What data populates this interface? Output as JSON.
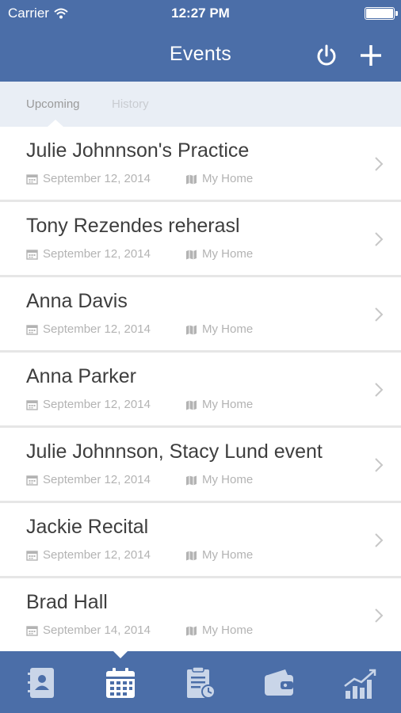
{
  "status_bar": {
    "carrier": "Carrier",
    "time": "12:27 PM"
  },
  "nav": {
    "title": "Events",
    "power_icon": "power-icon",
    "add_icon": "plus-icon"
  },
  "segments": {
    "upcoming": "Upcoming",
    "history": "History",
    "selected": "Upcoming"
  },
  "events": [
    {
      "title": "Julie Johnnson's Practice",
      "date": "September 12, 2014",
      "location": "My Home"
    },
    {
      "title": "Tony Rezendes reherasl",
      "date": "September 12, 2014",
      "location": "My Home"
    },
    {
      "title": "Anna Davis",
      "date": "September 12, 2014",
      "location": "My Home"
    },
    {
      "title": "Anna Parker",
      "date": "September 12, 2014",
      "location": "My Home"
    },
    {
      "title": "Julie Johnnson, Stacy Lund event",
      "date": "September 12, 2014",
      "location": "My Home"
    },
    {
      "title": "Jackie Recital",
      "date": "September 12, 2014",
      "location": "My Home"
    },
    {
      "title": "Brad Hall",
      "date": "September 14, 2014",
      "location": "My Home"
    }
  ],
  "tab_bar": {
    "items": [
      "contacts-book-icon",
      "calendar-icon",
      "clipboard-clock-icon",
      "wallet-icon",
      "bar-chart-trend-icon"
    ],
    "selected": "calendar-icon"
  },
  "colors": {
    "brand": "#4b6ea8",
    "segment_bg": "#e9eef5",
    "meta_text": "#b3b3b3",
    "title_text": "#3e3e3e"
  }
}
